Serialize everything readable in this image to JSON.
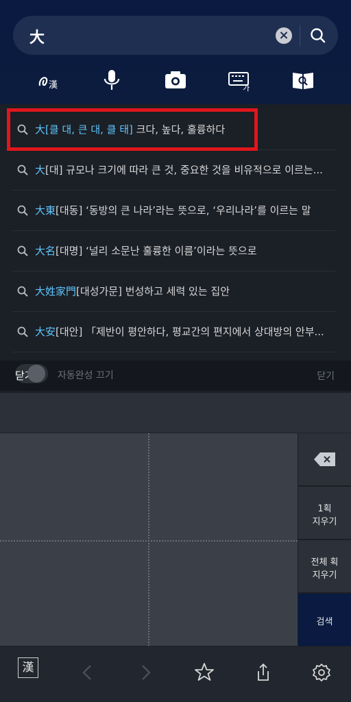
{
  "search": {
    "query": "大"
  },
  "suggestions": [
    {
      "hanja": "大",
      "reading": "[클 대, 큰 대, 클 태]",
      "meaning": " 크다, 높다, 훌륭하다"
    },
    {
      "hanja": "大",
      "reading": "[대]",
      "meaning": " 규모나 크기에 따라 큰 것, 중요한 것을 비유적으로 이르는..."
    },
    {
      "hanja": "大東",
      "reading": "[대동]",
      "meaning": " ‘동방의 큰 나라’라는 뜻으로, ‘우리나라’를 이르는 말"
    },
    {
      "hanja": "大名",
      "reading": "[대명]",
      "meaning": " ‘널리 소문난 훌륭한 이름’이라는 뜻으로"
    },
    {
      "hanja": "大姓家門",
      "reading": "[대성가문]",
      "meaning": " 번성하고 세력 있는 집안"
    },
    {
      "hanja": "大安",
      "reading": "[대안]",
      "meaning": " 「제반이 평안하다, 평교간의 편지에서 상대방의 안부..."
    }
  ],
  "autocomplete": {
    "toggle_label": "닫기",
    "label": "자동완성 끄기",
    "close": "닫기"
  },
  "keyboard": {
    "undo_one": [
      "1획",
      "지우기"
    ],
    "undo_all": [
      "전체 획",
      "지우기"
    ],
    "search": "검색"
  },
  "bottom": {
    "hanja_label": "漢"
  },
  "colors": {
    "header": "#0a1a40",
    "highlight": "#5fc7ff",
    "selection": "#e0161c"
  }
}
